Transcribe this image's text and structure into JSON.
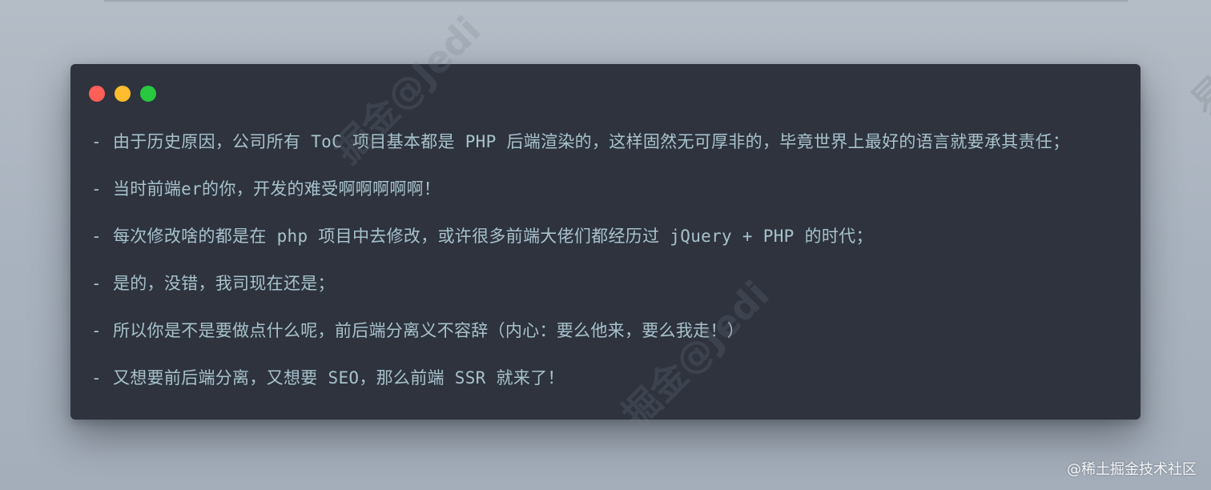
{
  "window": {
    "traffic_lights": [
      "red",
      "yellow",
      "green"
    ],
    "colors": {
      "red": "#fe5f57",
      "yellow": "#febc2e",
      "green": "#28c840",
      "background": "#2e333e",
      "text": "#a8c2cc"
    }
  },
  "content": {
    "bullet": "-",
    "lines": [
      "由于历史原因，公司所有 ToC 项目基本都是 PHP 后端渲染的，这样固然无可厚非的，毕竟世界上最好的语言就要承其责任；",
      "当时前端er的你，开发的难受啊啊啊啊啊！",
      "每次修改啥的都是在 php 项目中去修改，或许很多前端大佬们都经历过 jQuery + PHP 的时代；",
      "是的，没错，我司现在还是；",
      "所以你是不是要做点什么呢，前后端分离义不容辞（内心：要么他来，要么我走！）",
      "又想要前后端分离，又想要 SEO，那么前端 SSR 就来了！"
    ]
  },
  "watermarks": {
    "primary": "掘金@Jedi",
    "corner_glyph": "易"
  },
  "credit": "@稀土掘金技术社区"
}
